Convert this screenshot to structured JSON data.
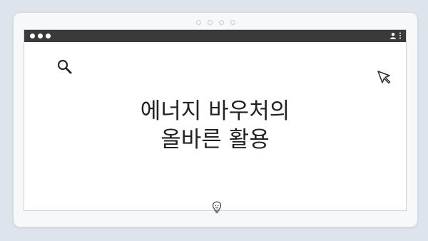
{
  "headline": {
    "line1": "에너지 바우처의",
    "line2": "올바른 활용"
  },
  "icons": {
    "search": "search-icon",
    "cursor": "cursor-arrow-icon",
    "bottom": "lightbulb-face-icon",
    "user": "user-icon",
    "menu": "kebab-menu-icon"
  },
  "colors": {
    "titlebar": "#3a3a3a",
    "background": "#dde4ec",
    "window": "#ffffff",
    "text": "#222222"
  }
}
